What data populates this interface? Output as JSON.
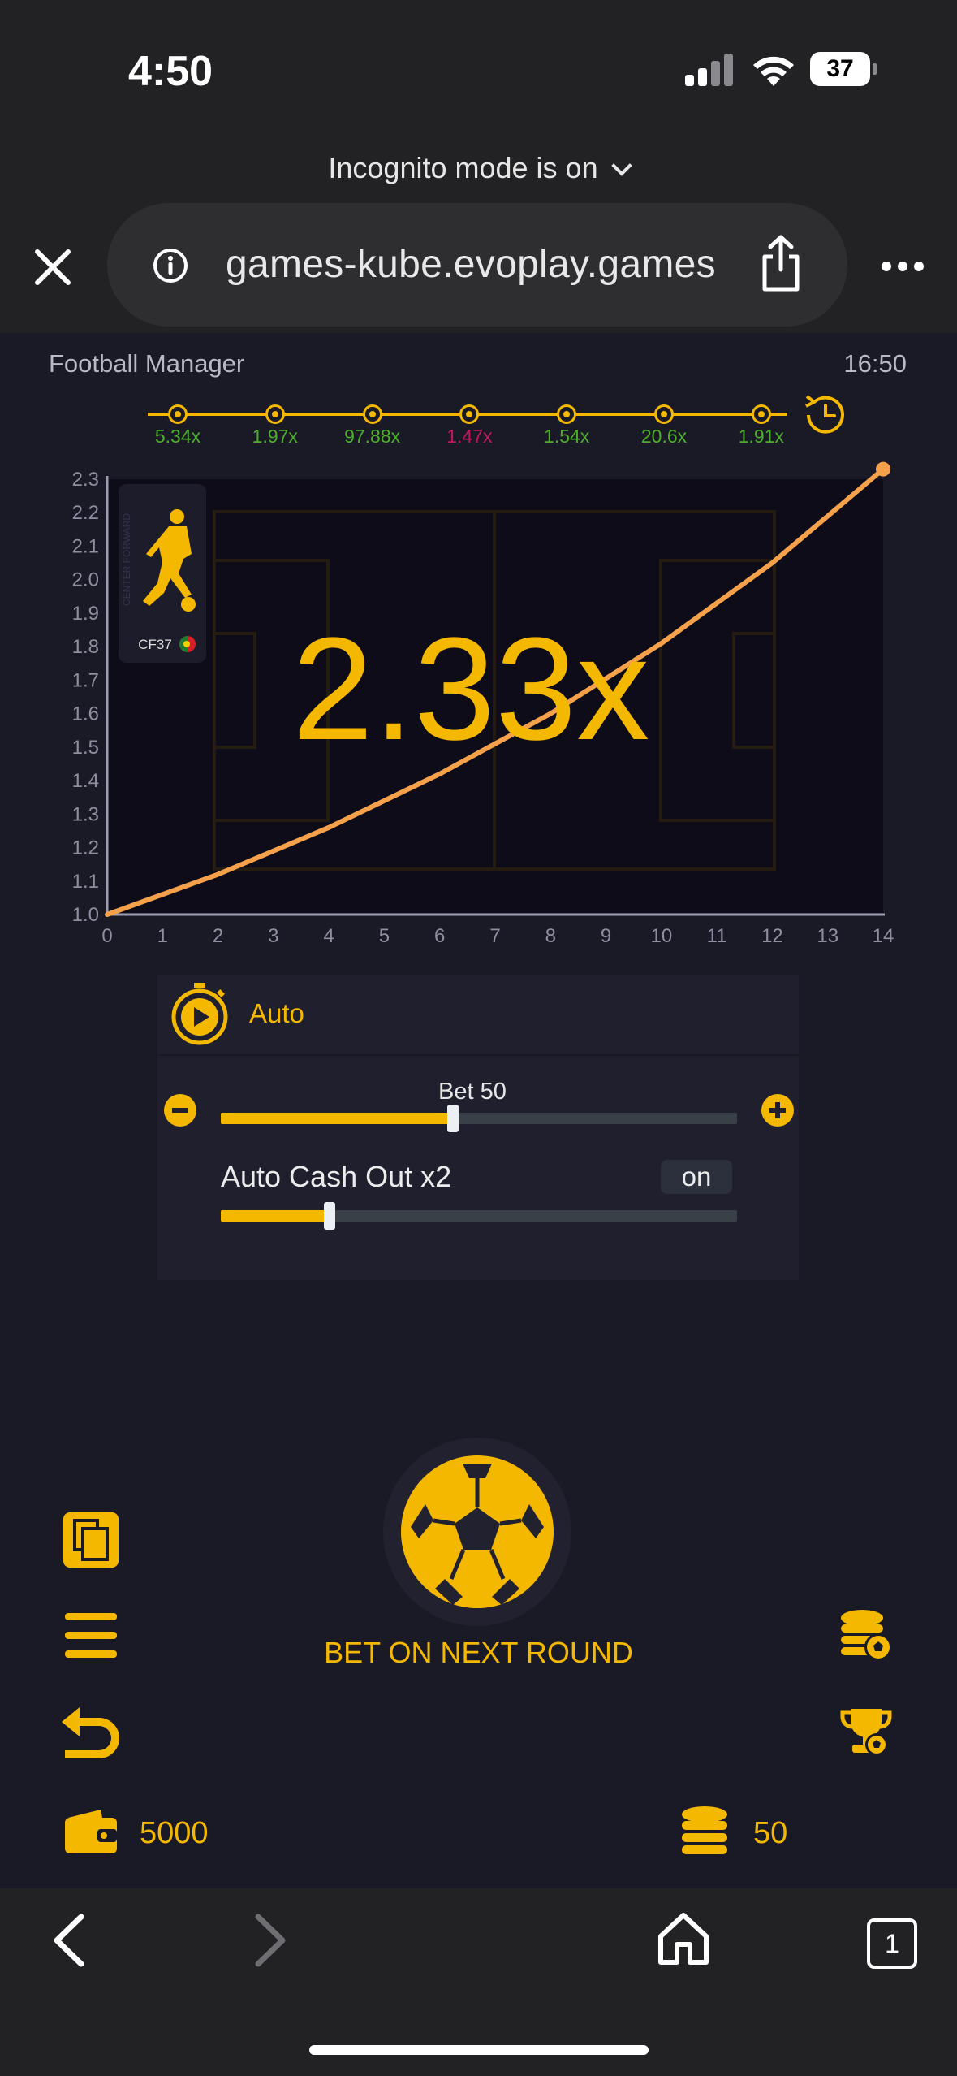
{
  "status_bar": {
    "time": "4:50",
    "battery": "37"
  },
  "browser": {
    "incognito_text": "Incognito mode is on",
    "url": "games-kube.evoplay.games",
    "tabs_count": "1"
  },
  "game": {
    "title": "Football Manager",
    "time": "16:50",
    "history": [
      {
        "value": "5.34x",
        "color": "#4caf2a"
      },
      {
        "value": "1.97x",
        "color": "#4caf2a"
      },
      {
        "value": "97.88x",
        "color": "#4caf2a"
      },
      {
        "value": "1.47x",
        "color": "#c2185b"
      },
      {
        "value": "1.54x",
        "color": "#4caf2a"
      },
      {
        "value": "20.6x",
        "color": "#4caf2a"
      },
      {
        "value": "1.91x",
        "color": "#4caf2a"
      }
    ],
    "current_multiplier": "2.33x",
    "player": {
      "label": "CF37",
      "position_text": "CENTER FORWARD"
    },
    "auto_label": "Auto",
    "bet_label": "Bet 50",
    "bet_fraction": 0.45,
    "auto_cashout_label": "Auto Cash Out x2",
    "auto_cashout_toggle": "on",
    "auto_cashout_fraction": 0.21,
    "bet_next_round": "BET ON NEXT ROUND",
    "balance": "5000",
    "stake": "50",
    "accent_color": "#f5b800"
  },
  "chart_data": {
    "type": "line",
    "x_ticks": [
      "0",
      "1",
      "2",
      "3",
      "4",
      "5",
      "6",
      "7",
      "8",
      "9",
      "10",
      "11",
      "12",
      "13",
      "14"
    ],
    "y_ticks": [
      "1.0",
      "1.1",
      "1.2",
      "1.3",
      "1.4",
      "1.5",
      "1.6",
      "1.7",
      "1.8",
      "1.9",
      "2.0",
      "2.1",
      "2.2",
      "2.3"
    ],
    "xlim": [
      0,
      14
    ],
    "ylim": [
      1.0,
      2.3
    ],
    "series": [
      {
        "x": [
          0,
          2,
          4,
          6,
          8,
          10,
          12,
          14
        ],
        "y": [
          1.0,
          1.12,
          1.26,
          1.42,
          1.6,
          1.81,
          2.05,
          2.33
        ]
      }
    ],
    "line_color": "#f5a04a"
  }
}
